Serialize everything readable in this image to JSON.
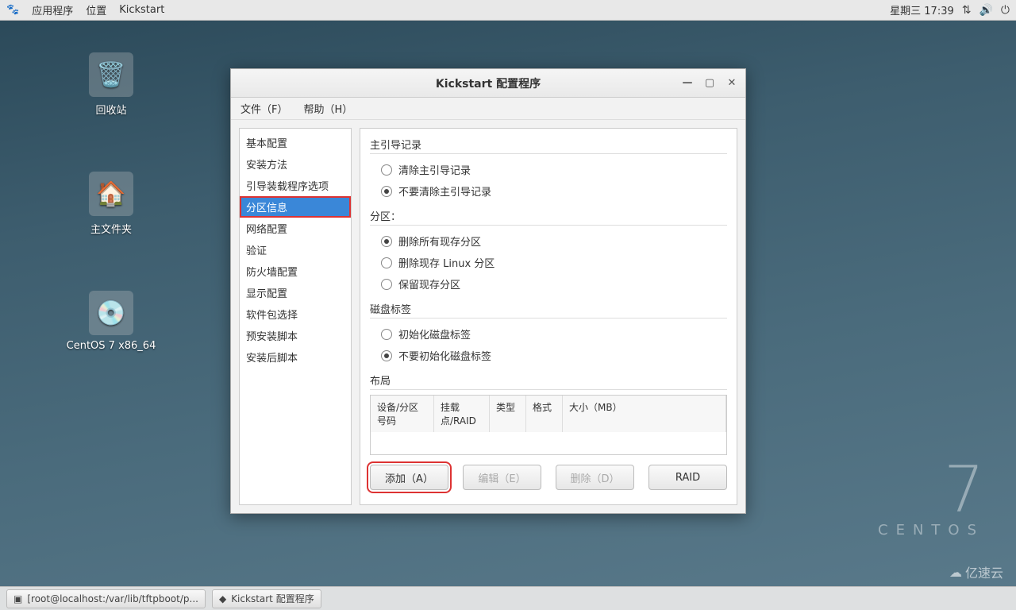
{
  "topbar": {
    "apps": "应用程序",
    "places": "位置",
    "kickstart": "Kickstart",
    "date": "星期三 17:39"
  },
  "desktop": {
    "trash": "回收站",
    "home": "主文件夹",
    "cd": "CentOS 7 x86_64"
  },
  "wallpaper": {
    "big": "7",
    "small": "CENTOS"
  },
  "window": {
    "title": "Kickstart 配置程序",
    "menu_file": "文件（F）",
    "menu_help": "帮助（H）",
    "sidebar": {
      "items": [
        "基本配置",
        "安装方法",
        "引导装载程序选项",
        "分区信息",
        "网络配置",
        "验证",
        "防火墙配置",
        "显示配置",
        "软件包选择",
        "预安装脚本",
        "安装后脚本"
      ],
      "selected_index": 3
    },
    "groups": {
      "mbr": {
        "title": "主引导记录",
        "opts": [
          "清除主引导记录",
          "不要清除主引导记录"
        ],
        "checked": 1
      },
      "partition": {
        "title": "分区：",
        "opts": [
          "删除所有现存分区",
          "删除现存 Linux 分区",
          "保留现存分区"
        ],
        "checked": 0
      },
      "disk": {
        "title": "磁盘标签",
        "opts": [
          "初始化磁盘标签",
          "不要初始化磁盘标签"
        ],
        "checked": 1
      },
      "layout": {
        "title": "布局",
        "headers": [
          "设备/分区号码",
          "挂载点/RAID",
          "类型",
          "格式",
          "大小（MB）"
        ]
      }
    },
    "buttons": {
      "add": "添加（A）",
      "edit": "编辑（E）",
      "delete": "删除（D）",
      "raid": "RAID"
    }
  },
  "taskbar": {
    "terminal": "[root@localhost:/var/lib/tftpboot/p...",
    "kickstart": "Kickstart 配置程序"
  },
  "watermark": "亿速云"
}
